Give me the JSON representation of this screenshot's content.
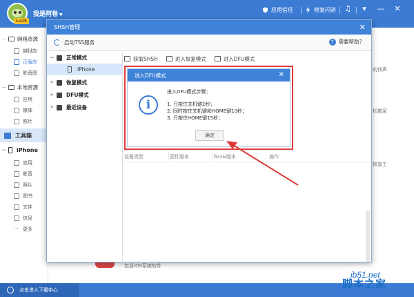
{
  "header": {
    "username": "我是阿卷",
    "level_badge": "Lv25",
    "app_trust": "应用信任",
    "flash": "修复闪退",
    "window_controls": [
      "♫",
      "▾",
      "—",
      "✕"
    ]
  },
  "sidebar": {
    "network_section": "网络资源",
    "network_items": [
      "越狱应",
      "正版应",
      "影音图"
    ],
    "local_section": "本地资源",
    "local_items": [
      "应用",
      "媒体",
      "照片"
    ],
    "toolbox": "工具箱",
    "device_section": "iPhone",
    "device_items": [
      "应用",
      "影音",
      "照片",
      "图书",
      "文件",
      "信息",
      "更多"
    ]
  },
  "background": {
    "ringtone": "的铃声",
    "move": "松搬家",
    "restore": "恢复工",
    "promo": "包含iOS系统软件"
  },
  "shsh_dialog": {
    "title": "SHSH管理",
    "start_tss": "启动TSS服务",
    "help": "需要帮助？",
    "modes": {
      "normal": "正常模式",
      "device": "iPhone",
      "recovery": "恢复模式",
      "dfu": "DFU模式",
      "recent": "最近设备"
    },
    "actions": [
      "获取SHSH",
      "进入恢复模式",
      "进入DFU模式"
    ],
    "columns": [
      "设备类型",
      "固件版本",
      "базы版本",
      "操作"
    ]
  },
  "dfu_dialog": {
    "title": "进入DFU模式",
    "heading": "进入DFU模式步骤：",
    "steps": [
      "1. 只按住关机键2秒；",
      "2. 同时按住关机键和HOME键10秒；",
      "3. 只按住HOME键15秒；"
    ],
    "ok": "确定"
  },
  "bottom": {
    "download_center": "点击进入下载中心"
  },
  "watermark": {
    "site": "jb51.net",
    "name": "脚本之家"
  },
  "colors": {
    "brand_blue": "#3b7bd3",
    "highlight_red": "#e03b3b"
  }
}
